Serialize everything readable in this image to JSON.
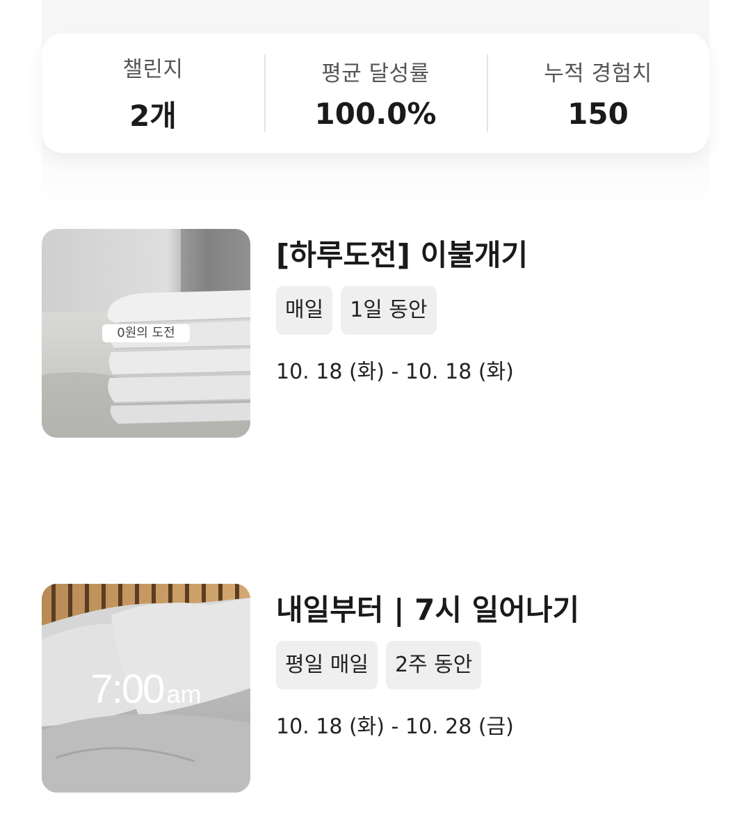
{
  "stats": [
    {
      "label": "챌린지",
      "value": "2개"
    },
    {
      "label": "평균 달성률",
      "value": "100.0%"
    },
    {
      "label": "누적 경험치",
      "value": "150"
    }
  ],
  "challenges": [
    {
      "title": "[하루도전] 이불개기",
      "tags": [
        "매일",
        "1일 동안"
      ],
      "date": "10. 18 (화) - 10. 18 (화)",
      "badge": "0원의 도전"
    },
    {
      "title": "내일부터 | 7시 일어나기",
      "tags": [
        "평일 매일",
        "2주 동안"
      ],
      "date": "10. 18 (화) - 10. 28 (금)",
      "overlay_time": "7:00",
      "overlay_suffix": "am"
    }
  ]
}
